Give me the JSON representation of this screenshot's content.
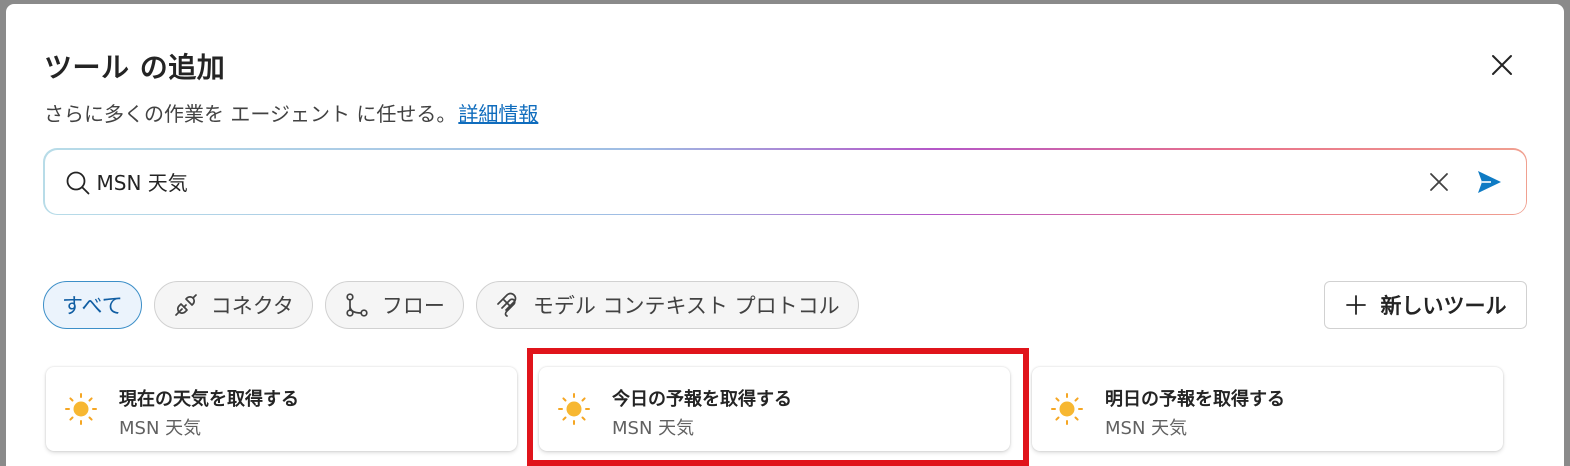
{
  "dialog": {
    "title": "ツール の追加",
    "subtitle": "さらに多くの作業を エージェント に任せる。",
    "learn_more": "詳細情報"
  },
  "search": {
    "value": "MSN 天気",
    "placeholder": ""
  },
  "filters": [
    {
      "label": "すべて",
      "icon": "none",
      "active": true
    },
    {
      "label": "コネクタ",
      "icon": "plug-icon",
      "active": false
    },
    {
      "label": "フロー",
      "icon": "flow-icon",
      "active": false
    },
    {
      "label": "モデル コンテキスト プロトコル",
      "icon": "mcp-icon",
      "active": false
    }
  ],
  "new_tool": {
    "label": "新しいツール",
    "icon": "plus-icon"
  },
  "results": [
    {
      "title": "現在の天気を取得する",
      "source": "MSN 天気",
      "icon": "sun-icon"
    },
    {
      "title": "今日の予報を取得する",
      "source": "MSN 天気",
      "icon": "sun-icon"
    },
    {
      "title": "明日の予報を取得する",
      "source": "MSN 天気",
      "icon": "sun-icon"
    }
  ],
  "colors": {
    "accent": "#0f6cbd",
    "send": "#0f7bc4",
    "highlight": "#e0141b",
    "sun": "#f7b731"
  }
}
